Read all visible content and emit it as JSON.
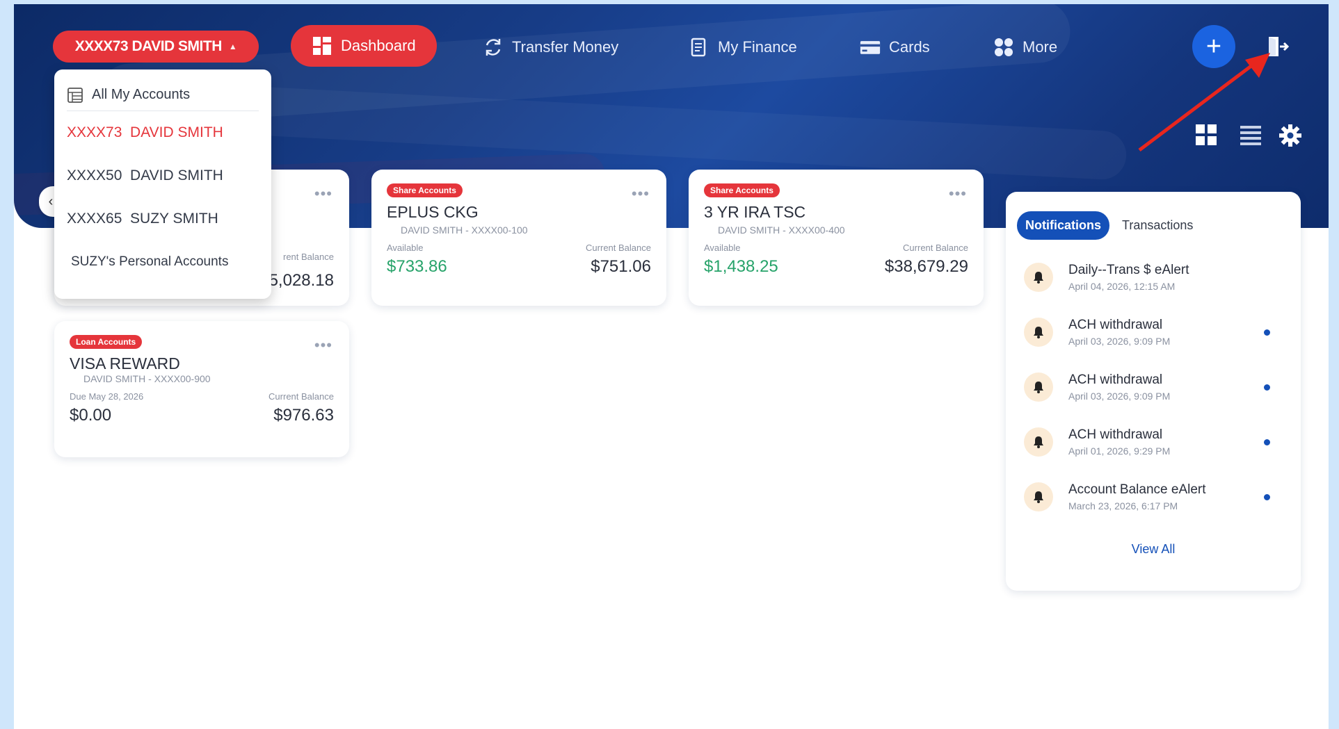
{
  "header": {
    "account_selector": "XXXX73 DAVID SMITH",
    "nav": [
      {
        "label": "Dashboard"
      },
      {
        "label": "Transfer Money"
      },
      {
        "label": "My Finance"
      },
      {
        "label": "Cards"
      },
      {
        "label": "More"
      }
    ],
    "add_label": "+"
  },
  "dropdown": {
    "items": [
      "All My Accounts",
      "XXXX73  DAVID SMITH",
      "XXXX50  DAVID SMITH",
      "XXXX65  SUZY SMITH",
      "SUZY's Personal Accounts"
    ]
  },
  "cards": [
    {
      "hidden_balance": "5,028.18",
      "hidden_label": "rent Balance"
    },
    {
      "badge": "Share Accounts",
      "name": "EPLUS CKG",
      "sub": "DAVID SMITH - XXXX00-100",
      "left_label": "Available",
      "right_label": "Current Balance",
      "left_value": "$733.86",
      "right_value": "$751.06"
    },
    {
      "badge": "Share Accounts",
      "name": "3 YR IRA TSC",
      "sub": "DAVID SMITH - XXXX00-400",
      "left_label": "Available",
      "right_label": "Current Balance",
      "left_value": "$1,438.25",
      "right_value": "$38,679.29"
    },
    {
      "badge": "Loan Accounts",
      "name": "VISA REWARD",
      "sub": "DAVID SMITH - XXXX00-900",
      "left_label": "Due May 28, 2026",
      "right_label": "Current Balance",
      "left_value": "$0.00",
      "right_value": "$976.63"
    }
  ],
  "notifications": {
    "tabs": [
      "Notifications",
      "Transactions"
    ],
    "items": [
      {
        "title": "Daily--Trans $ eAlert",
        "date": "April 04, 2026, 12:15 AM",
        "unread": false
      },
      {
        "title": "ACH withdrawal",
        "date": "April 03, 2026, 9:09 PM",
        "unread": true
      },
      {
        "title": "ACH withdrawal",
        "date": "April 03, 2026, 9:09 PM",
        "unread": true
      },
      {
        "title": "ACH withdrawal",
        "date": "April 01, 2026, 9:29 PM",
        "unread": true
      },
      {
        "title": "Account Balance eAlert",
        "date": "March 23, 2026, 6:17 PM",
        "unread": true
      }
    ],
    "view_all": "View All"
  },
  "colors": {
    "accent_red": "#e5353b",
    "primary_blue": "#1450b8",
    "balance_green": "#27a36a"
  }
}
